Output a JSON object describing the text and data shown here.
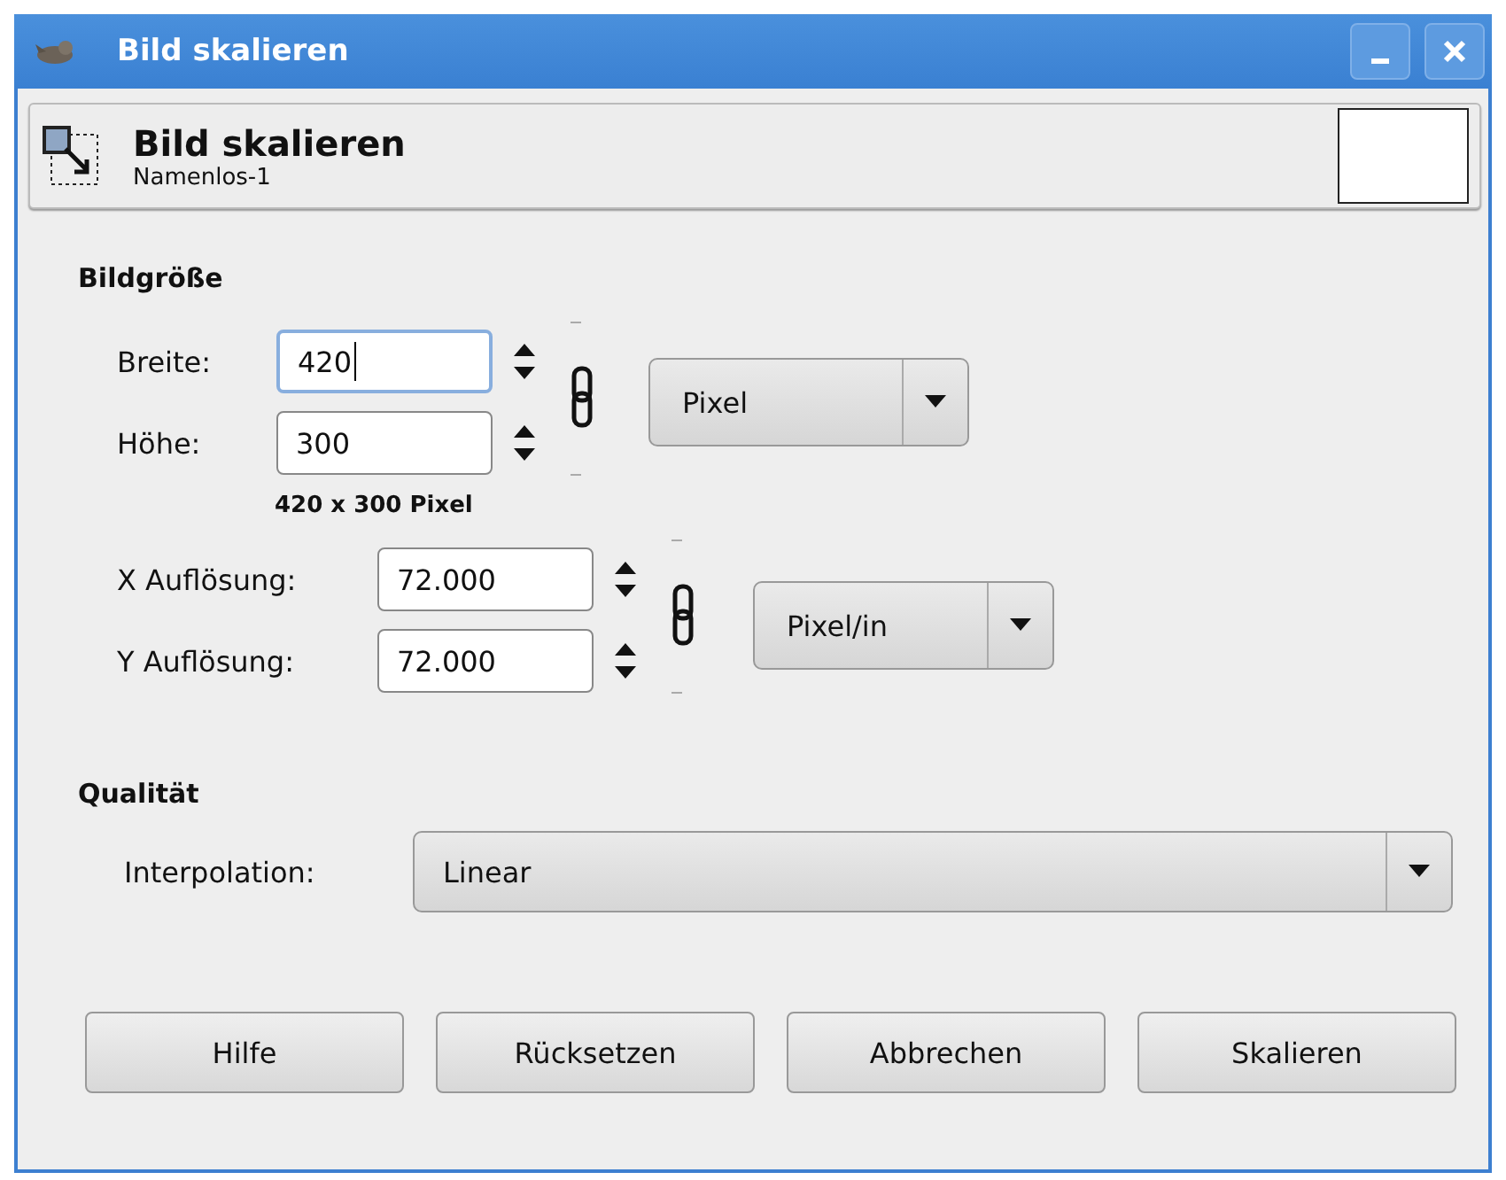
{
  "window": {
    "title": "Bild skalieren"
  },
  "header": {
    "title": "Bild skalieren",
    "subtitle": "Namenlos-1"
  },
  "size_section": {
    "heading": "Bildgröße",
    "fields": [
      {
        "label": "Breite:",
        "value": "420",
        "focused": true
      },
      {
        "label": "Höhe:",
        "value": "300",
        "focused": false
      }
    ],
    "chain_linked": true,
    "unit": "Pixel",
    "summary": "420 x 300 Pixel",
    "resolution_fields": [
      {
        "label": "X Auflösung:",
        "value": "72.000",
        "focused": false
      },
      {
        "label": "Y Auflösung:",
        "value": "72.000",
        "focused": false
      }
    ],
    "resolution_chain_linked": true,
    "resolution_unit": "Pixel/in"
  },
  "quality_section": {
    "heading": "Qualität",
    "interpolation_label": "Interpolation:",
    "interpolation": "Linear"
  },
  "buttons": [
    "Hilfe",
    "Rücksetzen",
    "Abbrechen",
    "Skalieren"
  ]
}
